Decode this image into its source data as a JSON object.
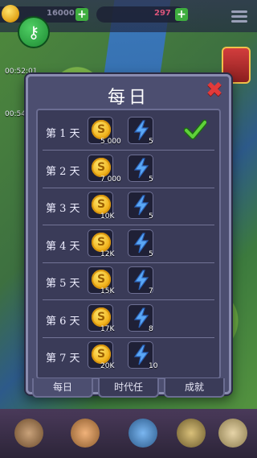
{
  "hud": {
    "coins": "16000",
    "gems": "297",
    "timer_1": "00:52:01",
    "timer_2": "00:54"
  },
  "dialog": {
    "title": "每日",
    "close_icon": "close-x-icon",
    "rows": [
      {
        "day": "第 1 天",
        "coins": "5 000",
        "energy": "5",
        "claimed": true
      },
      {
        "day": "第 2 天",
        "coins": "7 000",
        "energy": "5",
        "claimed": false
      },
      {
        "day": "第 3 天",
        "coins": "10K",
        "energy": "5",
        "claimed": false
      },
      {
        "day": "第 4 天",
        "coins": "12K",
        "energy": "5",
        "claimed": false
      },
      {
        "day": "第 5 天",
        "coins": "15K",
        "energy": "7",
        "claimed": false
      },
      {
        "day": "第 6 天",
        "coins": "17K",
        "energy": "8",
        "claimed": false
      },
      {
        "day": "第 7 天",
        "coins": "20K",
        "energy": "10",
        "claimed": false
      }
    ]
  },
  "tabs": [
    {
      "label": "每日",
      "active": true
    },
    {
      "label": "时代任",
      "active": false
    },
    {
      "label": "成就",
      "active": false
    }
  ],
  "colors": {
    "accent_green": "#3fae3f",
    "close_red": "#e23a3a",
    "panel": "#4c4e70"
  }
}
